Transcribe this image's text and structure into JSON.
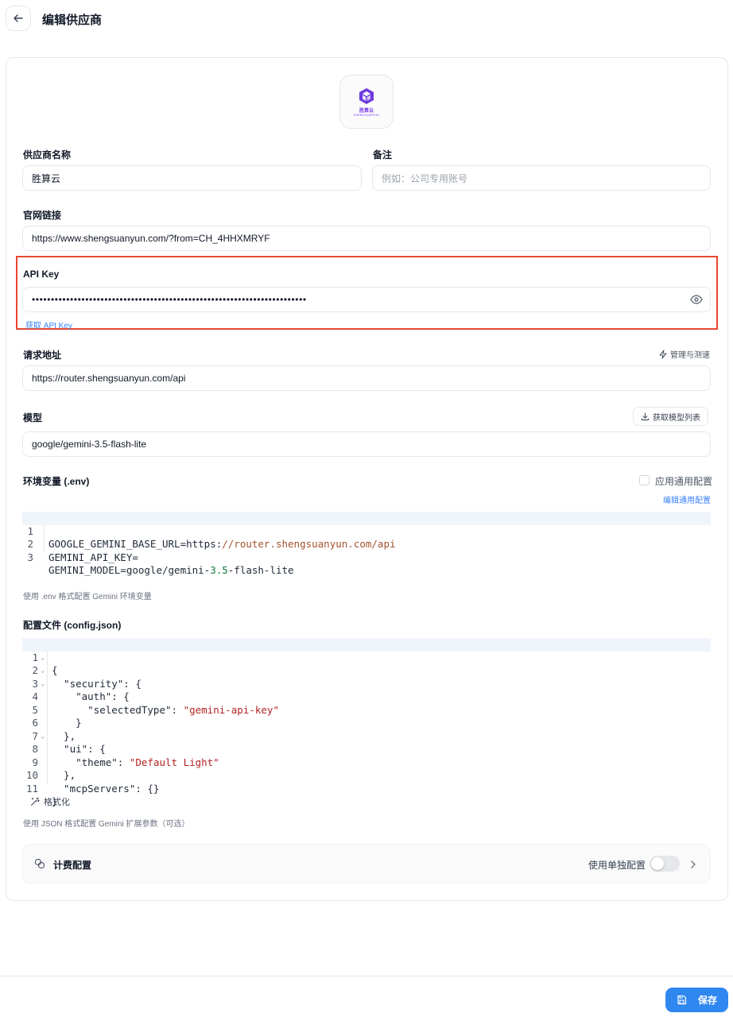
{
  "header": {
    "title": "编辑供应商"
  },
  "logo": {
    "text": "胜算云",
    "subtext": "SHENGSUANYUN"
  },
  "form": {
    "provider_name": {
      "label": "供应商名称",
      "value": "胜算云"
    },
    "note": {
      "label": "备注",
      "placeholder": "例如：公司专用账号"
    },
    "website": {
      "label": "官网链接",
      "value": "https://www.shengsuanyun.com/?from=CH_4HHXMRYF"
    },
    "api_key": {
      "label": "API Key",
      "masked_value": "••••••••••••••••••••••••••••••••••••••••••••••••••••••••••••••••••••••••",
      "get_link": "获取 API Key"
    },
    "endpoint": {
      "label": "请求地址",
      "action": "管理与测速",
      "value": "https://router.shengsuanyun.com/api"
    },
    "model": {
      "label": "模型",
      "action": "获取模型列表",
      "value": "google/gemini-3.5-flash-lite"
    },
    "env": {
      "label": "环境变量 (.env)",
      "checkbox_label": "应用通用配置",
      "edit_link": "编辑通用配置",
      "help": "使用 .env 格式配置 Gemini 环境变量",
      "lines": [
        "GOOGLE_GEMINI_BASE_URL=https://router.shengsuanyun.com/api",
        "GEMINI_API_KEY=",
        "GEMINI_MODEL=google/gemini-3.5-flash-lite"
      ]
    },
    "config": {
      "label": "配置文件 (config.json)",
      "format_button": "格式化",
      "help": "使用 JSON 格式配置 Gemini 扩展参数（可选）",
      "lines": [
        "{",
        "  \"security\": {",
        "    \"auth\": {",
        "      \"selectedType\": \"gemini-api-key\"",
        "    }",
        "  },",
        "  \"ui\": {",
        "    \"theme\": \"Default Light\"",
        "  },",
        "  \"mcpServers\": {}",
        "}"
      ]
    }
  },
  "billing": {
    "label": "计费配置",
    "toggle_label": "使用单独配置",
    "toggle_on": false
  },
  "footer": {
    "save_label": "保存"
  },
  "colors": {
    "accent": "#2f87f0",
    "highlight_border": "#e8472f",
    "logo": "#7c3aed"
  }
}
